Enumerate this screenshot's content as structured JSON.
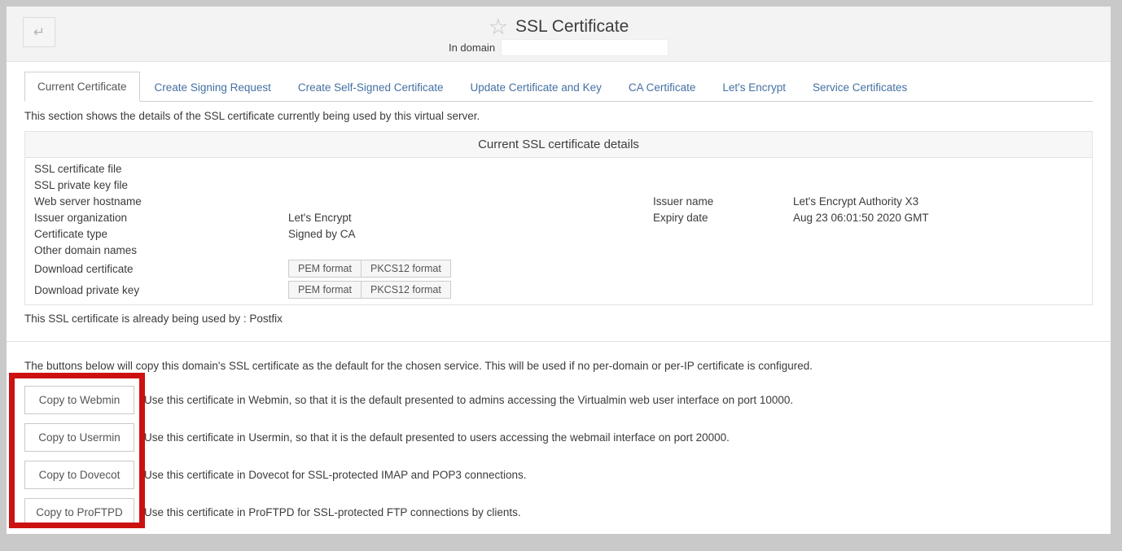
{
  "header": {
    "title": "SSL Certificate",
    "in_domain_label": "In domain",
    "domain_value": ""
  },
  "icons": {
    "back": "↵",
    "star": "☆"
  },
  "tabs": [
    {
      "label": "Current Certificate",
      "active": true
    },
    {
      "label": "Create Signing Request",
      "active": false
    },
    {
      "label": "Create Self-Signed Certificate",
      "active": false
    },
    {
      "label": "Update Certificate and Key",
      "active": false
    },
    {
      "label": "CA Certificate",
      "active": false
    },
    {
      "label": "Let's Encrypt",
      "active": false
    },
    {
      "label": "Service Certificates",
      "active": false
    }
  ],
  "intro": "This section shows the details of the SSL certificate currently being used by this virtual server.",
  "details": {
    "title": "Current SSL certificate details",
    "rows": [
      {
        "label": "SSL certificate file",
        "value": "",
        "label2": "",
        "value2": ""
      },
      {
        "label": "SSL private key file",
        "value": "",
        "label2": "",
        "value2": ""
      },
      {
        "label": "Web server hostname",
        "value": "",
        "label2": "Issuer name",
        "value2": "Let's Encrypt Authority X3"
      },
      {
        "label": "Issuer organization",
        "value": "Let's Encrypt",
        "label2": "Expiry date",
        "value2": "Aug 23 06:01:50 2020 GMT"
      },
      {
        "label": "Certificate type",
        "value": "Signed by CA",
        "label2": "",
        "value2": ""
      },
      {
        "label": "Other domain names",
        "value": "",
        "label2": "",
        "value2": ""
      },
      {
        "label": "Download certificate",
        "buttons": [
          "PEM format",
          "PKCS12 format"
        ]
      },
      {
        "label": "Download private key",
        "buttons": [
          "PEM format",
          "PKCS12 format"
        ]
      }
    ]
  },
  "used_by": "This SSL certificate is already being used by : Postfix",
  "copy_section": {
    "intro": "The buttons below will copy this domain's SSL certificate as the default for the chosen service. This will be used if no per-domain or per-IP certificate is configured.",
    "buttons": [
      {
        "label": "Copy to Webmin",
        "description": "Use this certificate in Webmin, so that it is the default presented to admins accessing the Virtualmin web user interface on port 10000."
      },
      {
        "label": "Copy to Usermin",
        "description": "Use this certificate in Usermin, so that it is the default presented to users accessing the webmail interface on port 20000."
      },
      {
        "label": "Copy to Dovecot",
        "description": "Use this certificate in Dovecot for SSL-protected IMAP and POP3 connections."
      },
      {
        "label": "Copy to ProFTPD",
        "description": "Use this certificate in ProFTPD for SSL-protected FTP connections by clients."
      }
    ]
  },
  "colors": {
    "tab_link_blue": "#4470a3",
    "annotation_red": "#cc1111",
    "header_gray": "#f3f3f3",
    "frame_gray": "#c9c9c9"
  }
}
